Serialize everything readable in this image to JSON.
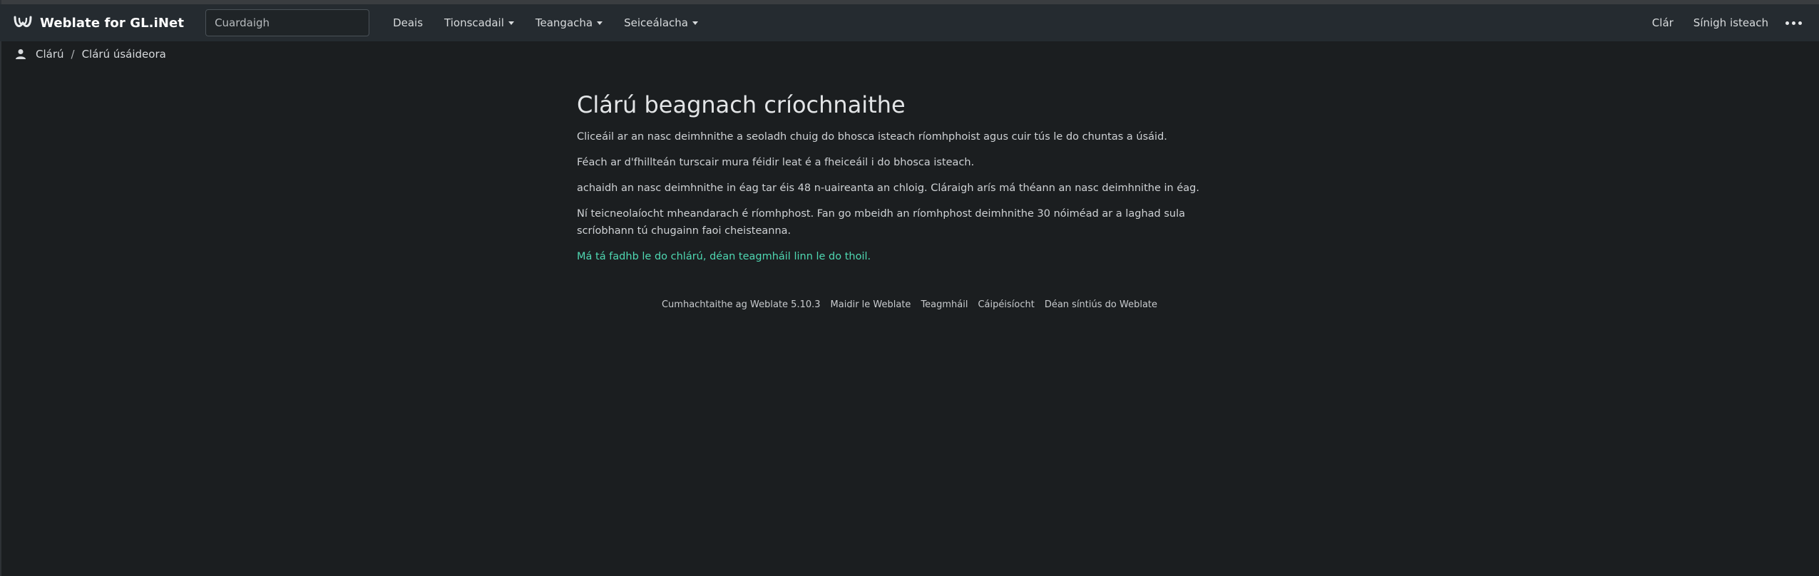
{
  "navbar": {
    "brand": "Weblate for GL.iNet",
    "search_placeholder": "Cuardaigh",
    "items": [
      {
        "label": "Deais",
        "has_caret": false
      },
      {
        "label": "Tionscadail",
        "has_caret": true
      },
      {
        "label": "Teangacha",
        "has_caret": true
      },
      {
        "label": "Seiceálacha",
        "has_caret": true
      }
    ],
    "right": {
      "register": "Clár",
      "signin": "Sínigh isteach"
    },
    "icons": {
      "logo": "weblate-logo-icon",
      "more": "more-dots-icon"
    }
  },
  "breadcrumb": {
    "icon": "user-icon",
    "items": [
      "Clárú",
      "Clárú úsáideora"
    ]
  },
  "main": {
    "title": "Clárú beagnach críochnaithe",
    "paragraphs": [
      "Cliceáil ar an nasc deimhnithe a seoladh chuig do bhosca isteach ríomhphoist agus cuir tús le do chuntas a úsáid.",
      "Féach ar d'fhillteán turscair mura féidir leat é a fheiceáil i do bhosca isteach.",
      "achaidh an nasc deimhnithe in éag tar éis 48 n-uaireanta an chloig. Cláraigh arís má théann an nasc deimhnithe in éag.",
      "Ní teicneolaíocht mheandarach é ríomhphost. Fan go mbeidh an ríomhphost deimhnithe 30 nóiméad ar a laghad sula scríobhann tú chugainn faoi cheisteanna."
    ],
    "help_link": "Má tá fadhb le do chlárú, déan teagmháil linn le do thoil."
  },
  "footer": {
    "links": [
      "Cumhachtaithe ag Weblate 5.10.3",
      "Maidir le Weblate",
      "Teagmháil",
      "Cáipéisíocht",
      "Déan síntiús do Weblate"
    ]
  },
  "colors": {
    "background": "#1b1e20",
    "navbar": "#252b30",
    "accent_link": "#4fd8b2"
  }
}
